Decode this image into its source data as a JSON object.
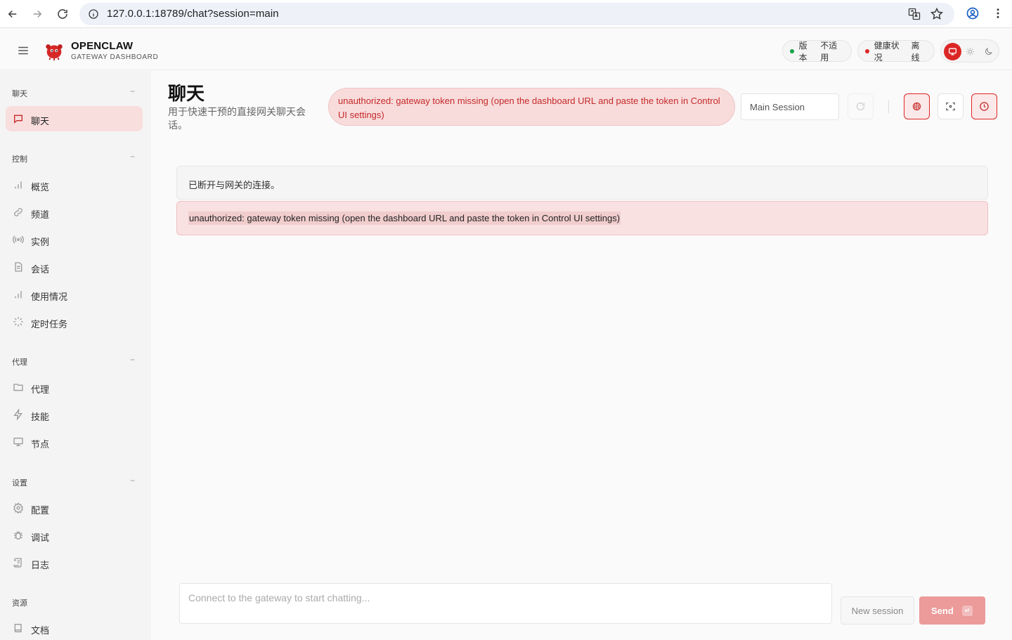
{
  "browser": {
    "url": "127.0.0.1:18789/chat?session=main"
  },
  "header": {
    "brand_title": "OPENCLAW",
    "brand_subtitle": "GATEWAY DASHBOARD",
    "version_label": "版本",
    "version_value": "不适用",
    "health_label": "健康状况",
    "health_value": "离线",
    "status_colors": {
      "version_dot": "#16a34a",
      "health_dot": "#dc2626",
      "accent": "#dc2626"
    }
  },
  "sidebar": {
    "sections": [
      {
        "title": "聊天",
        "toggle": "−",
        "items": [
          {
            "label": "聊天",
            "icon": "message-icon",
            "active": true
          }
        ]
      },
      {
        "title": "控制",
        "toggle": "−",
        "items": [
          {
            "label": "概览",
            "icon": "bar-chart-icon"
          },
          {
            "label": "频道",
            "icon": "link-icon"
          },
          {
            "label": "实例",
            "icon": "radio-icon"
          },
          {
            "label": "会话",
            "icon": "file-icon"
          },
          {
            "label": "使用情况",
            "icon": "bar-chart-icon"
          },
          {
            "label": "定时任务",
            "icon": "loader-icon"
          }
        ]
      },
      {
        "title": "代理",
        "toggle": "−",
        "items": [
          {
            "label": "代理",
            "icon": "folder-icon"
          },
          {
            "label": "技能",
            "icon": "zap-icon"
          },
          {
            "label": "节点",
            "icon": "monitor-icon"
          }
        ]
      },
      {
        "title": "设置",
        "toggle": "−",
        "items": [
          {
            "label": "配置",
            "icon": "gear-icon"
          },
          {
            "label": "调试",
            "icon": "bug-icon"
          },
          {
            "label": "日志",
            "icon": "scroll-icon"
          }
        ]
      },
      {
        "title": "资源",
        "items": [
          {
            "label": "文档",
            "icon": "book-icon"
          }
        ]
      }
    ]
  },
  "main": {
    "title": "聊天",
    "subtitle": "用于快速干预的直接网关聊天会话。",
    "error_banner": "unauthorized: gateway token missing (open the dashboard URL and paste the token in Control UI settings)",
    "session_select_value": "Main Session",
    "notice": "已断开与网关的连接。",
    "error_message": "unauthorized: gateway token missing (open the dashboard URL and paste the token in Control UI settings)",
    "composer_placeholder": "Connect to the gateway to start chatting...",
    "new_session_label": "New session",
    "send_label": "Send",
    "send_kbd": "↵"
  }
}
